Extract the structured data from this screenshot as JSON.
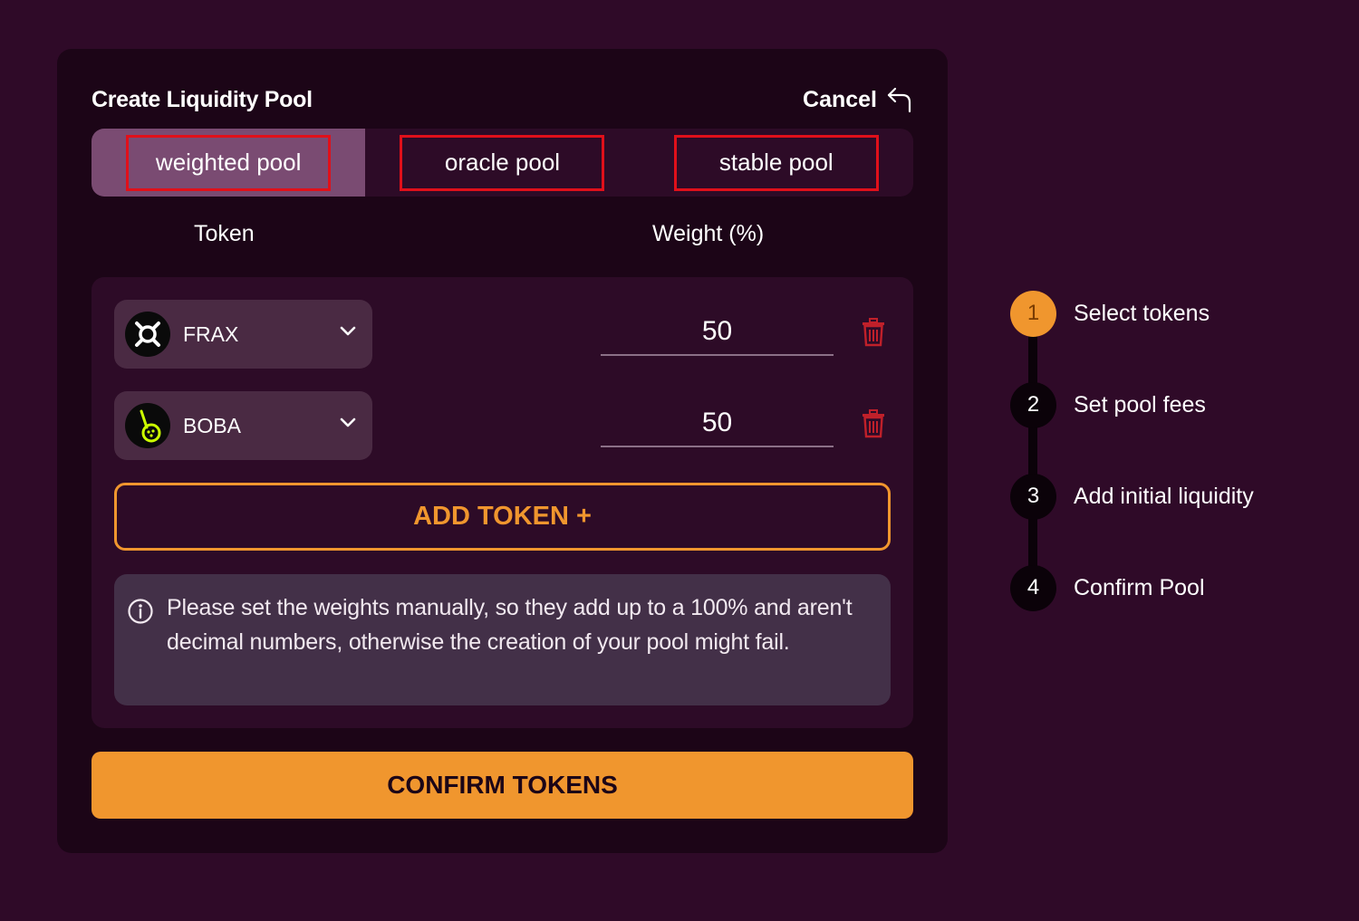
{
  "header": {
    "title": "Create Liquidity Pool",
    "cancel_label": "Cancel"
  },
  "pool_types": [
    {
      "label": "weighted pool",
      "active": true
    },
    {
      "label": "oracle pool",
      "active": false
    },
    {
      "label": "stable pool",
      "active": false
    }
  ],
  "columns": {
    "token": "Token",
    "weight": "Weight (%)"
  },
  "tokens": [
    {
      "symbol": "FRAX",
      "icon": "frax-logo-icon",
      "weight": "50"
    },
    {
      "symbol": "BOBA",
      "icon": "boba-logo-icon",
      "weight": "50"
    }
  ],
  "add_token_label": "ADD TOKEN +",
  "info_message": "Please set the weights manually, so they add up to a 100% and aren't decimal numbers, otherwise the creation of your pool might fail.",
  "confirm_label": "CONFIRM TOKENS",
  "steps": [
    {
      "number": "1",
      "label": "Select tokens",
      "active": true
    },
    {
      "number": "2",
      "label": "Set pool fees",
      "active": false
    },
    {
      "number": "3",
      "label": "Add initial liquidity",
      "active": false
    },
    {
      "number": "4",
      "label": "Confirm Pool",
      "active": false
    }
  ],
  "colors": {
    "background": "#2f0a28",
    "card": "#1c0517",
    "accent": "#f0962e",
    "active_tab": "#7a4b72",
    "highlight_border": "#e0101a",
    "delete": "#c0202a"
  }
}
